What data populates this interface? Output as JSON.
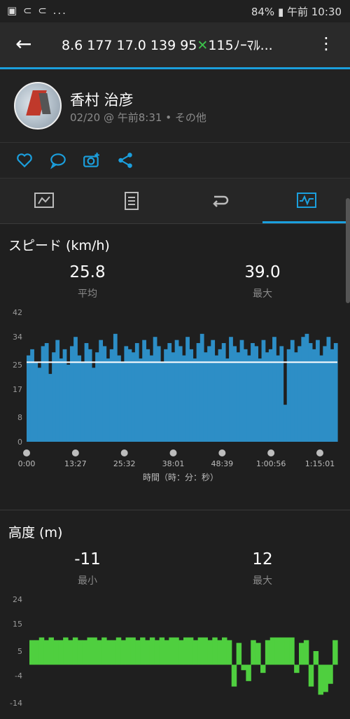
{
  "status": {
    "left_icons": "▣ ⊂ ⊂ ...",
    "battery": "84%",
    "time": "午前 10:30"
  },
  "appbar": {
    "title_prefix": "8.6  177  17.0  139  95",
    "title_suffix": "115ﾉｰﾏﾙ...",
    "back_icon": "arrow-left-icon",
    "more_icon": "more-vert-icon"
  },
  "profile": {
    "name": "香村 治彦",
    "meta": "02/20 @ 午前8:31 • その他"
  },
  "colors": {
    "accent": "#1b9fdd",
    "speed_fill": "#2d8ec6",
    "elev_fill": "#4fcf3f"
  },
  "speed": {
    "title": "スピード (km/h)",
    "avg_value": "25.8",
    "avg_label": "平均",
    "max_value": "39.0",
    "max_label": "最大"
  },
  "elevation": {
    "title": "高度 (m)",
    "min_value": "-11",
    "min_label": "最小",
    "max_value": "12",
    "max_label": "最大"
  },
  "chart_data": [
    {
      "type": "area",
      "ylim": [
        0,
        42
      ],
      "yticks": [
        "42",
        "34",
        "25",
        "17",
        "8",
        "0"
      ],
      "xticks": [
        "0:00",
        "13:27",
        "25:32",
        "38:01",
        "48:39",
        "1:00:56",
        "1:15:01"
      ],
      "xlabel": "時間（時：分：秒）",
      "average_line": 25.8,
      "series": [
        {
          "values": [
            28,
            30,
            26,
            24,
            31,
            32,
            22,
            29,
            33,
            27,
            30,
            25,
            31,
            34,
            28,
            26,
            32,
            30,
            24,
            29,
            33,
            31,
            27,
            30,
            35,
            28,
            26,
            31,
            30,
            29,
            32,
            27,
            33,
            30,
            28,
            34,
            31,
            26,
            30,
            32,
            29,
            33,
            31,
            28,
            34,
            30,
            27,
            32,
            35,
            29,
            31,
            33,
            28,
            30,
            32,
            27,
            34,
            31,
            29,
            33,
            30,
            28,
            32,
            31,
            27,
            33,
            29,
            30,
            34,
            28,
            31,
            12,
            30,
            33,
            29,
            31,
            34,
            35,
            32,
            30,
            33,
            28,
            31,
            34,
            30,
            32
          ]
        }
      ]
    },
    {
      "type": "area",
      "ylim": [
        -14,
        24
      ],
      "yticks": [
        "24",
        "15",
        "5",
        "-4",
        "-14"
      ],
      "series": [
        {
          "values": [
            9,
            9,
            10,
            9,
            10,
            9,
            9,
            10,
            9,
            10,
            9,
            9,
            10,
            10,
            9,
            10,
            9,
            9,
            10,
            9,
            10,
            10,
            9,
            10,
            9,
            10,
            9,
            10,
            9,
            10,
            10,
            9,
            10,
            10,
            9,
            10,
            10,
            9,
            10,
            9,
            10,
            9,
            -8,
            8,
            -2,
            -6,
            9,
            8,
            -3,
            9,
            10,
            10,
            10,
            10,
            10,
            -3,
            8,
            9,
            -8,
            5,
            -11,
            -10,
            -7,
            9
          ]
        }
      ]
    }
  ]
}
